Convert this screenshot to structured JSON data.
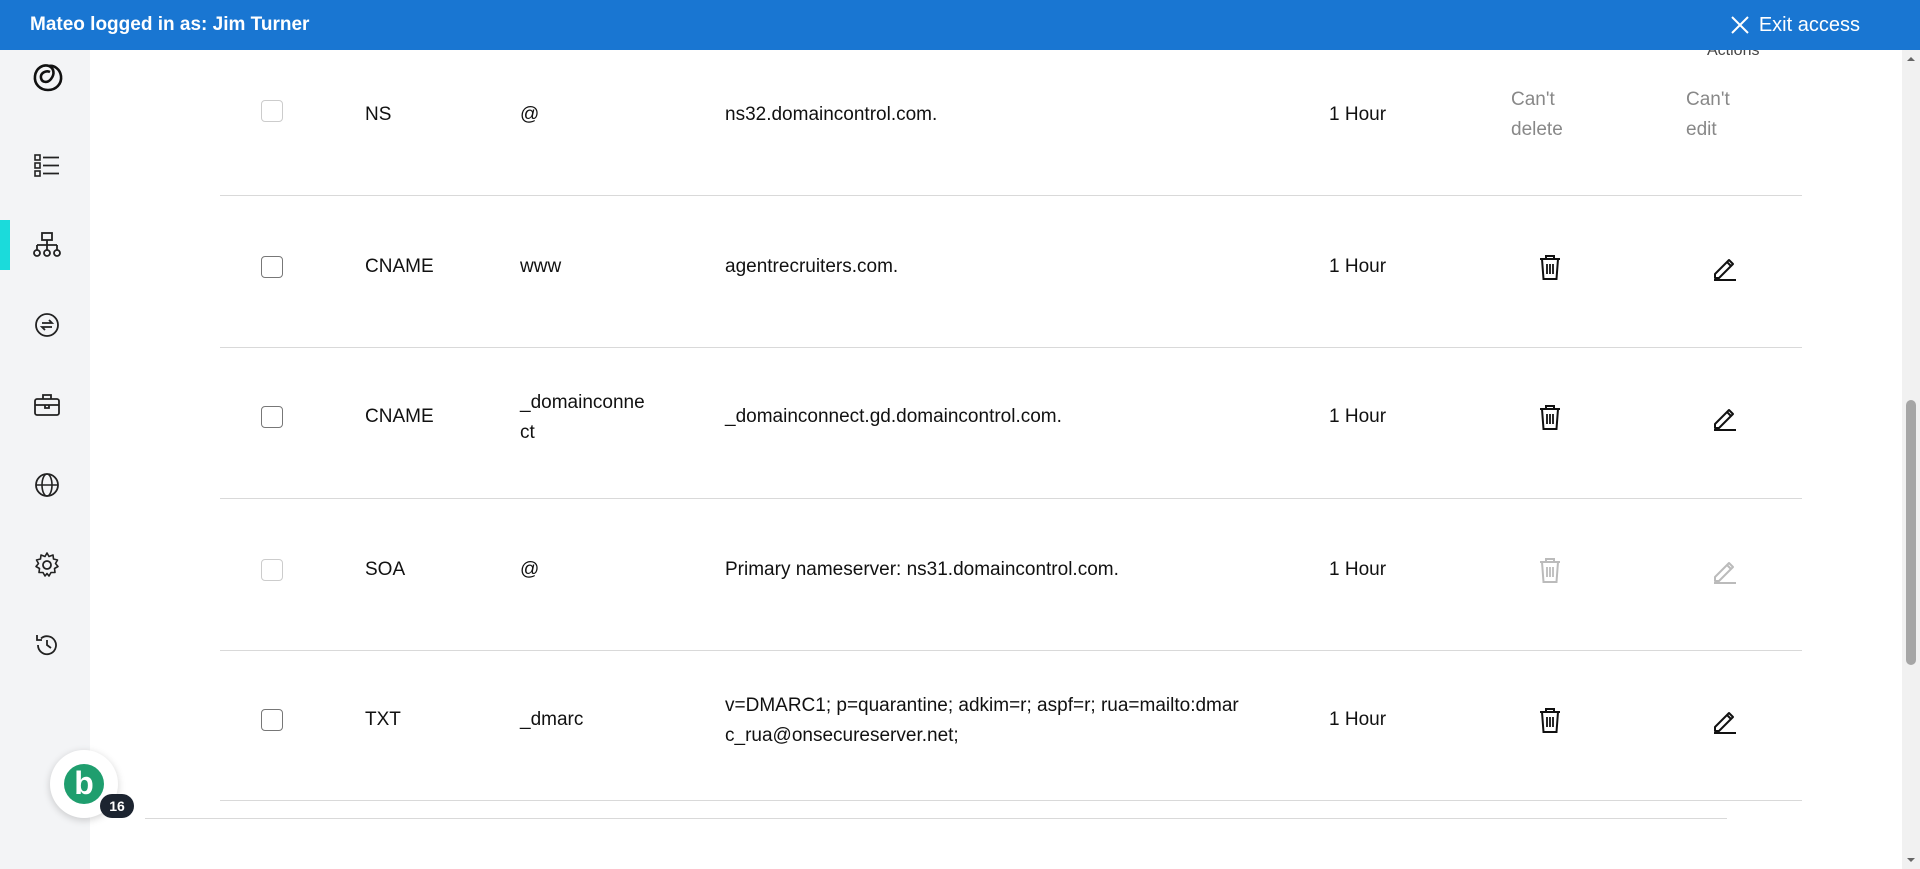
{
  "banner": {
    "text": "Mateo logged in as: Jim Turner",
    "exit_label": "Exit access"
  },
  "table": {
    "actions_header": "Actions",
    "rows": [
      {
        "type": "NS",
        "name": "@",
        "value": "ns32.domaincontrol.com.",
        "ttl": "1 Hour",
        "delete_text": "Can't delete",
        "edit_text": "Can't edit"
      },
      {
        "type": "CNAME",
        "name": "www",
        "value": "agentrecruiters.com.",
        "ttl": "1 Hour"
      },
      {
        "type": "CNAME",
        "name": "_domainconnect",
        "value": "_domainconnect.gd.domaincontrol.com.",
        "ttl": "1 Hour"
      },
      {
        "type": "SOA",
        "name": "@",
        "value": "Primary nameserver: ns31.domaincontrol.com.",
        "ttl": "1 Hour"
      },
      {
        "type": "TXT",
        "name": "_dmarc",
        "value": "v=DMARC1; p=quarantine; adkim=r; aspf=r; rua=mailto:dmarc_rua@onsecureserver.net;",
        "ttl": "1 Hour"
      }
    ]
  },
  "assistant": {
    "letter": "b",
    "badge_count": "16"
  },
  "colors": {
    "banner": "#1976d2",
    "active_nav": "#1bdbdb",
    "assistant": "#1f9e6e"
  }
}
